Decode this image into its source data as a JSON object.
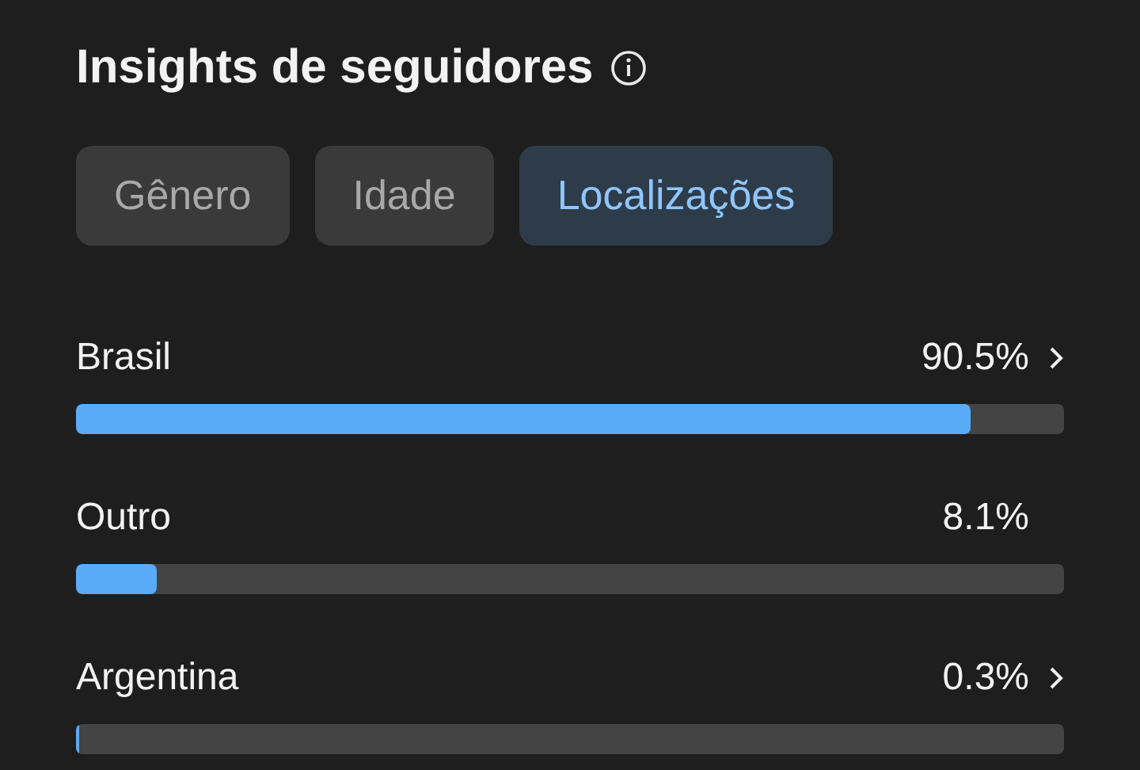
{
  "title": "Insights de seguidores",
  "tabs": [
    {
      "label": "Gênero",
      "selected": false
    },
    {
      "label": "Idade",
      "selected": false
    },
    {
      "label": "Localizações",
      "selected": true
    }
  ],
  "locations": [
    {
      "name": "Brasil",
      "percent": "90.5%",
      "level": 0.905,
      "has_detail": true
    },
    {
      "name": "Outro",
      "percent": "8.1%",
      "level": 0.081,
      "has_detail": false
    },
    {
      "name": "Argentina",
      "percent": "0.3%",
      "level": 0.003,
      "has_detail": true
    }
  ]
}
